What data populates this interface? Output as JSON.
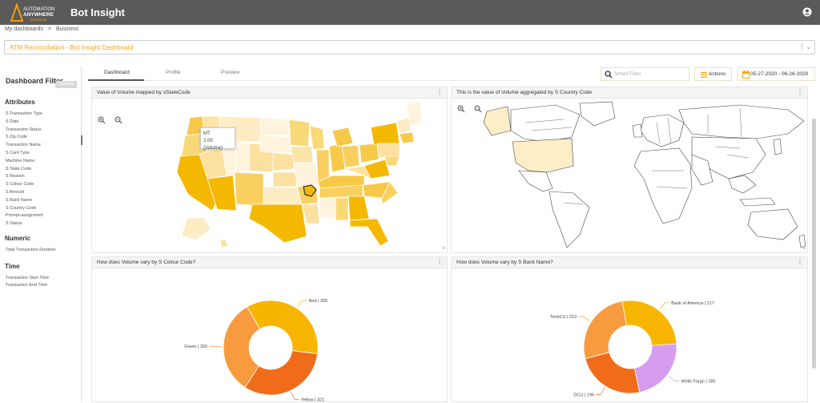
{
  "app": {
    "logo_line1": "AUTOMATION",
    "logo_line2": "ANYWHERE",
    "logo_line3": "Enterprise",
    "title": "Bot Insight"
  },
  "breadcrumb": {
    "root": "My dashboards",
    "current": "Business"
  },
  "dashboard_selector": {
    "value": "ATM Reconciliation - Bot Insight Dashboard"
  },
  "tabs": [
    {
      "label": "Dashboard"
    },
    {
      "label": "Profile"
    },
    {
      "label": "Preview"
    }
  ],
  "toolbar": {
    "smart_filter_placeholder": "Smart Filter",
    "actions_label": "Actions",
    "date_range": "05-27-2020 - 06-26-2020"
  },
  "sidebar": {
    "title": "Dashboard Filter",
    "clear_all": "Clear All",
    "attributes_title": "Attributes",
    "attributes": [
      "S Transaction Type",
      "S Date",
      "Transaction Status",
      "S Zip Code",
      "Transaction Name",
      "S Card Type",
      "Machine Name",
      "S State Code",
      "S Reason",
      "S Colour Code",
      "S Amount",
      "S Bank Name",
      "S Country Code",
      "Prompt-assignment",
      "S Status"
    ],
    "numeric_title": "Numeric",
    "numeric": [
      "Total Transaction Duration"
    ],
    "time_title": "Time",
    "time": [
      "Transaction Start Time",
      "Transaction End Time"
    ]
  },
  "widgets": {
    "us_map": {
      "title": "Value of Volume mapped by sStateCode",
      "tooltip_state": "MT",
      "tooltip_value": "2.00 (Volume)"
    },
    "world_map": {
      "title": "This is the value of Volume aggregated by S Country Code"
    },
    "colour_donut": {
      "title": "How does Volume vary by S Colour Code?"
    },
    "bank_donut": {
      "title": "How does Volume vary by S Bank Name?"
    }
  },
  "colors": {
    "topbar": "#5a5a5a",
    "accent": "#f3a712",
    "red": "#f7b500",
    "yellow": "#f06c1a",
    "green": "#f79b3e",
    "pink": "#f5a3e2",
    "purple": "#d69cf0"
  },
  "chart_data": [
    {
      "type": "pie",
      "chart": "colour_donut",
      "categories": [
        "Red",
        "Yellow",
        "Green"
      ],
      "values": [
        355,
        321,
        326
      ],
      "labels": [
        "Red | 355",
        "Yellow | 321",
        "Green | 326"
      ]
    },
    {
      "type": "pie",
      "chart": "bank_donut",
      "categories": [
        "Bank of America",
        "Wells Fargo",
        "DCU",
        "TechCU"
      ],
      "values": [
        217,
        185,
        196,
        213
      ],
      "labels": [
        "Bank of America | 217",
        "Wells Fargo | 185",
        "DCU | 196",
        "TechCU | 213"
      ]
    }
  ]
}
